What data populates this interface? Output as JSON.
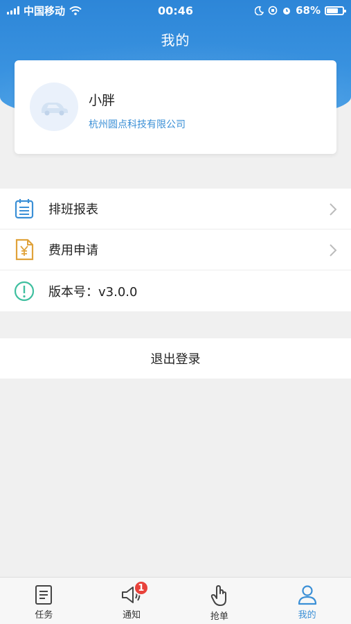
{
  "status_bar": {
    "carrier": "中国移动",
    "time": "00:46",
    "battery": "68%"
  },
  "header": {
    "title": "我的"
  },
  "profile": {
    "name": "小胖",
    "company": "杭州圆点科技有限公司",
    "avatar_icon": "car-avatar-icon"
  },
  "menu": {
    "items": [
      {
        "label": "排班报表",
        "icon": "schedule-report-icon",
        "color": "#3a8fd6"
      },
      {
        "label": "费用申请",
        "icon": "yuan-document-icon",
        "color": "#e0a23a"
      },
      {
        "label": "版本号：v3.0.0",
        "icon": "info-circle-icon",
        "color": "#3fbf9f"
      }
    ]
  },
  "logout": {
    "label": "退出登录"
  },
  "tabbar": {
    "tabs": [
      {
        "label": "任务",
        "icon": "task-list-icon"
      },
      {
        "label": "通知",
        "icon": "speaker-icon",
        "badge": "1"
      },
      {
        "label": "抢单",
        "icon": "tap-hand-icon"
      },
      {
        "label": "我的",
        "icon": "user-icon",
        "active": true
      }
    ]
  },
  "colors": {
    "accent": "#3a8fd6",
    "header": "#2d86d8",
    "badge": "#e8423b"
  }
}
